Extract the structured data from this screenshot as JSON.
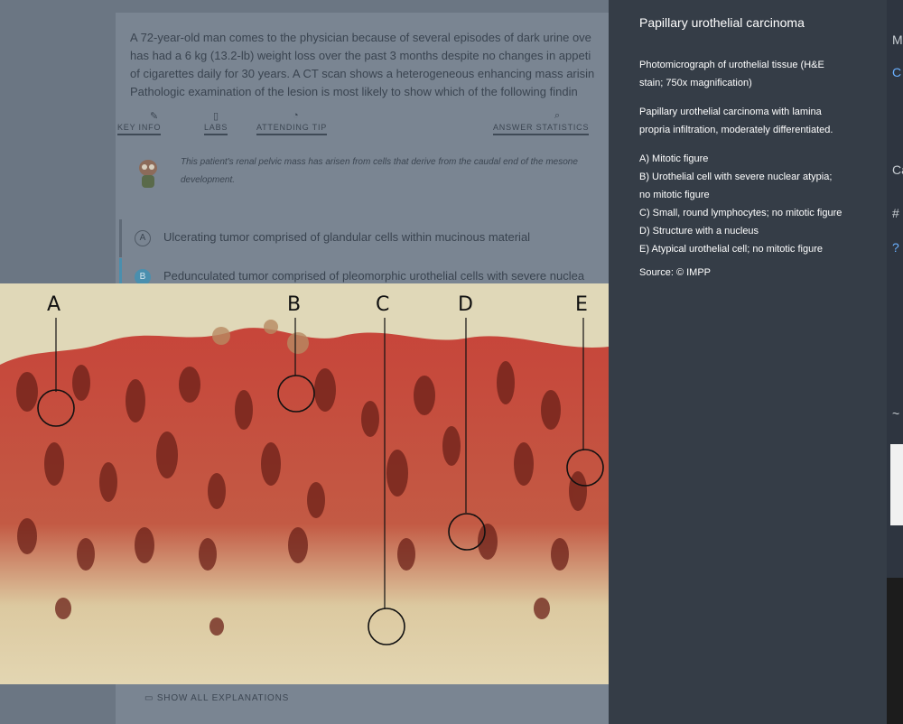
{
  "question": {
    "stem": [
      "A 72-year-old man comes to the physician because of several episodes of dark urine ove",
      "has had a 6 kg (13.2-lb) weight loss over the past 3 months despite no changes in appeti",
      "of cigarettes daily for 30 years. A CT scan shows a heterogeneous enhancing mass arisin",
      "Pathologic examination of the lesion is most likely to show which of the following findin"
    ],
    "tabs": [
      "KEY INFO",
      "LABS",
      "ATTENDING TIP",
      "ANSWER STATISTICS"
    ],
    "tip": [
      "This patient's renal pelvic mass has arisen from cells that derive from the caudal end of the mesone",
      "development."
    ],
    "choices": [
      {
        "letter": "A",
        "text": "Ulcerating tumor comprised of glandular cells within mucinous material"
      },
      {
        "letter": "B",
        "text": "Pedunculated tumor comprised of pleomorphic urothelial cells with severe nuclea"
      }
    ],
    "explain_link": "SHOW ALL EXPLANATIONS"
  },
  "micrograph": {
    "labels": [
      "A",
      "B",
      "C",
      "D",
      "E"
    ]
  },
  "panel": {
    "title": "Papillary urothelial carcinoma",
    "caption": [
      "Photomicrograph of urothelial tissue (H&E",
      "stain; 750x magnification)"
    ],
    "description": [
      "Papillary urothelial carcinoma with lamina",
      "propria infiltration, moderately differentiated."
    ],
    "legend": [
      "A) Mitotic figure",
      "B) Urothelial cell with severe nuclear atypia;",
      "no mitotic figure",
      "C) Small, round lymphocytes; no mitotic figure",
      "D) Structure with a nucleus",
      "E) Atypical urothelial cell; no mitotic figure"
    ],
    "source": "Source: © IMPP"
  },
  "edge": {
    "glyphs": [
      "M",
      "C",
      "Ca",
      "#",
      "?",
      "~"
    ]
  },
  "colors": {
    "panel_bg": "#353d47",
    "selected_choice": "#4a8fae"
  }
}
